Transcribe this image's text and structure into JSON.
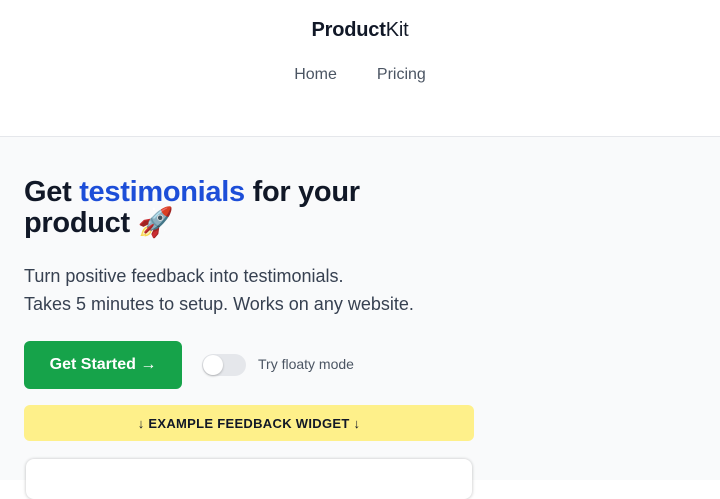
{
  "header": {
    "brand_bold": "Product",
    "brand_light": "Kit",
    "nav": [
      {
        "label": "Home"
      },
      {
        "label": "Pricing"
      }
    ]
  },
  "hero": {
    "headline_prefix": "Get ",
    "headline_accent": "testimonials",
    "headline_suffix": " for your product 🚀",
    "subtitle_line1": "Turn positive feedback into testimonials.",
    "subtitle_line2": "Takes 5 minutes to setup. Works on any website.",
    "cta_label": "Get Started →",
    "toggle_label": "Try floaty mode",
    "toggle_on": false,
    "banner_label": "↓ EXAMPLE FEEDBACK WIDGET ↓"
  },
  "colors": {
    "accent": "#1d4ed8",
    "cta": "#16a34a",
    "banner": "#fef08a"
  }
}
